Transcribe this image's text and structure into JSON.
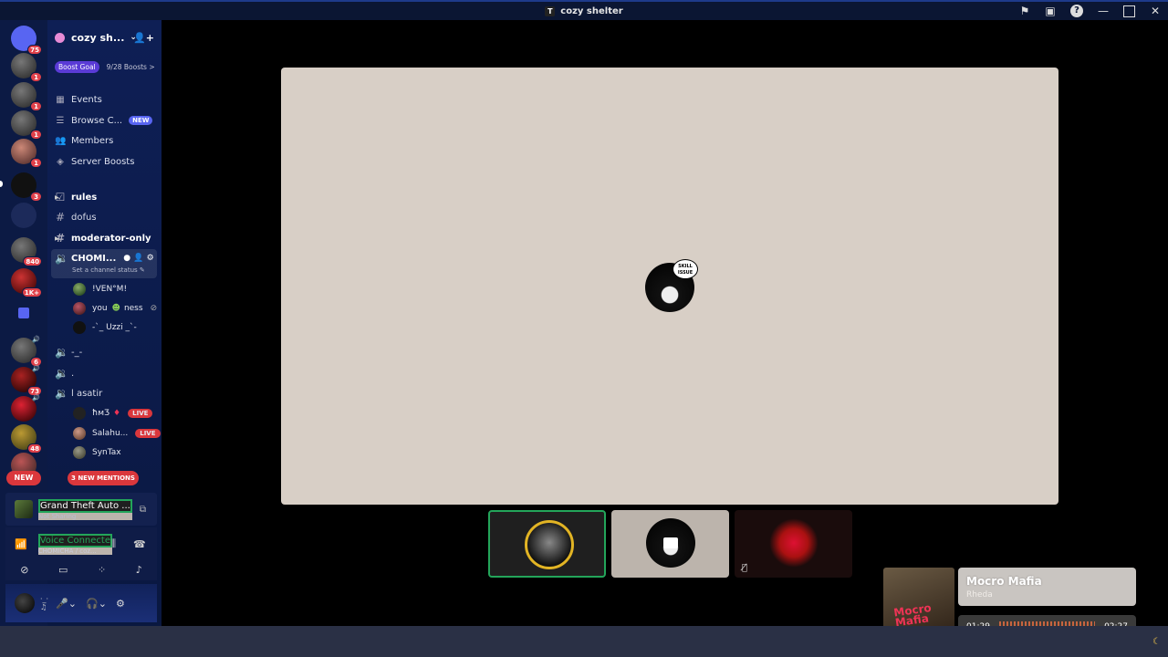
{
  "window": {
    "title": "cozy shelter"
  },
  "rail": {
    "badges": [
      "75",
      "1",
      "1",
      "1",
      "1",
      "3",
      "840",
      "1K+",
      "6",
      "73",
      "48"
    ],
    "new_label": "NEW"
  },
  "server": {
    "name": "cozy sh...",
    "boost_goal_label": "Boost Goal",
    "boost_count": "9/28 Boosts >"
  },
  "nav": {
    "items": [
      {
        "label": "Events",
        "icon": "calendar-icon"
      },
      {
        "label": "Browse C...",
        "icon": "browse-icon",
        "tag": "NEW"
      },
      {
        "label": "Members",
        "icon": "members-icon"
      },
      {
        "label": "Server Boosts",
        "icon": "boost-icon"
      }
    ]
  },
  "channels": {
    "rules": "rules",
    "dofus": "dofus",
    "moderator_only": "moderator-only",
    "active_voice": "CHOMI...",
    "status_prompt": "Set a channel status",
    "voice_users": [
      "!VEN°M!",
      "you",
      "-`_ Uzzi _`-"
    ],
    "voice_user_2_extra": "ness",
    "v2": "-_-",
    "v3": ".",
    "v4": "l asatir",
    "v4_users": [
      "ħᴍƷ",
      "Salahu...",
      "SynTax"
    ],
    "live_label": "LIVE"
  },
  "mentions_label": "3 NEW MENTIONS",
  "activity": {
    "game": "Grand Theft Auto ...",
    "status": "Not Sharing"
  },
  "voice": {
    "status": "Voice Connecte",
    "channel": "CHOMICHA / coz..."
  },
  "stage": {
    "sticker_text": "SKILL ISSUE"
  },
  "music": {
    "song": "Mocro Mafia",
    "artist": "Rheda",
    "elapsed": "01:29",
    "total": "02:27",
    "art_text": "Mocro Mafia",
    "progress": 0.6
  },
  "colors": {
    "accent": "#5865f2",
    "live": "#da373c",
    "connected": "#23a55a",
    "music": "#e06b40"
  }
}
